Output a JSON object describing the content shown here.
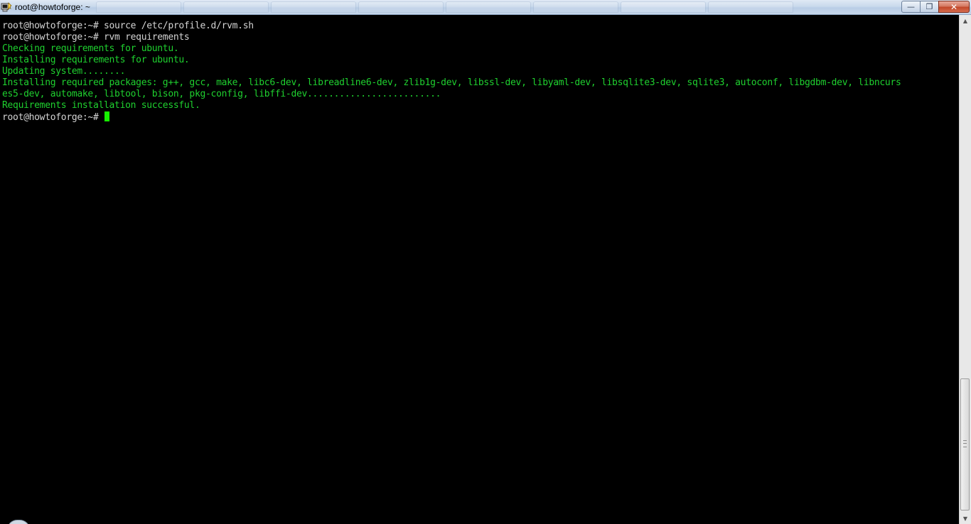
{
  "window": {
    "title": "root@howtoforge: ~",
    "controls": {
      "minimize_symbol": "—",
      "maximize_symbol": "❐",
      "close_symbol": "✕"
    },
    "icon": "putty-terminal-icon"
  },
  "terminal": {
    "colors": {
      "background": "#000000",
      "prompt_text": "#d4d4d4",
      "output_text": "#1fd12f",
      "cursor": "#16f000"
    },
    "lines": [
      {
        "text": "root@howtoforge:~# source /etc/profile.d/rvm.sh",
        "color": "white"
      },
      {
        "text": "root@howtoforge:~# rvm requirements",
        "color": "white"
      },
      {
        "text": "Checking requirements for ubuntu.",
        "color": "green"
      },
      {
        "text": "Installing requirements for ubuntu.",
        "color": "green"
      },
      {
        "text": "Updating system........",
        "color": "green"
      },
      {
        "text": "Installing required packages: g++, gcc, make, libc6-dev, libreadline6-dev, zlib1g-dev, libssl-dev, libyaml-dev, libsqlite3-dev, sqlite3, autoconf, libgdbm-dev, libncurs",
        "color": "green"
      },
      {
        "text": "es5-dev, automake, libtool, bison, pkg-config, libffi-dev.........................",
        "color": "green"
      },
      {
        "text": "Requirements installation successful.",
        "color": "green"
      }
    ],
    "prompt": "root@howtoforge:~# "
  },
  "scrollbar": {
    "up_symbol": "▲",
    "down_symbol": "▼"
  }
}
